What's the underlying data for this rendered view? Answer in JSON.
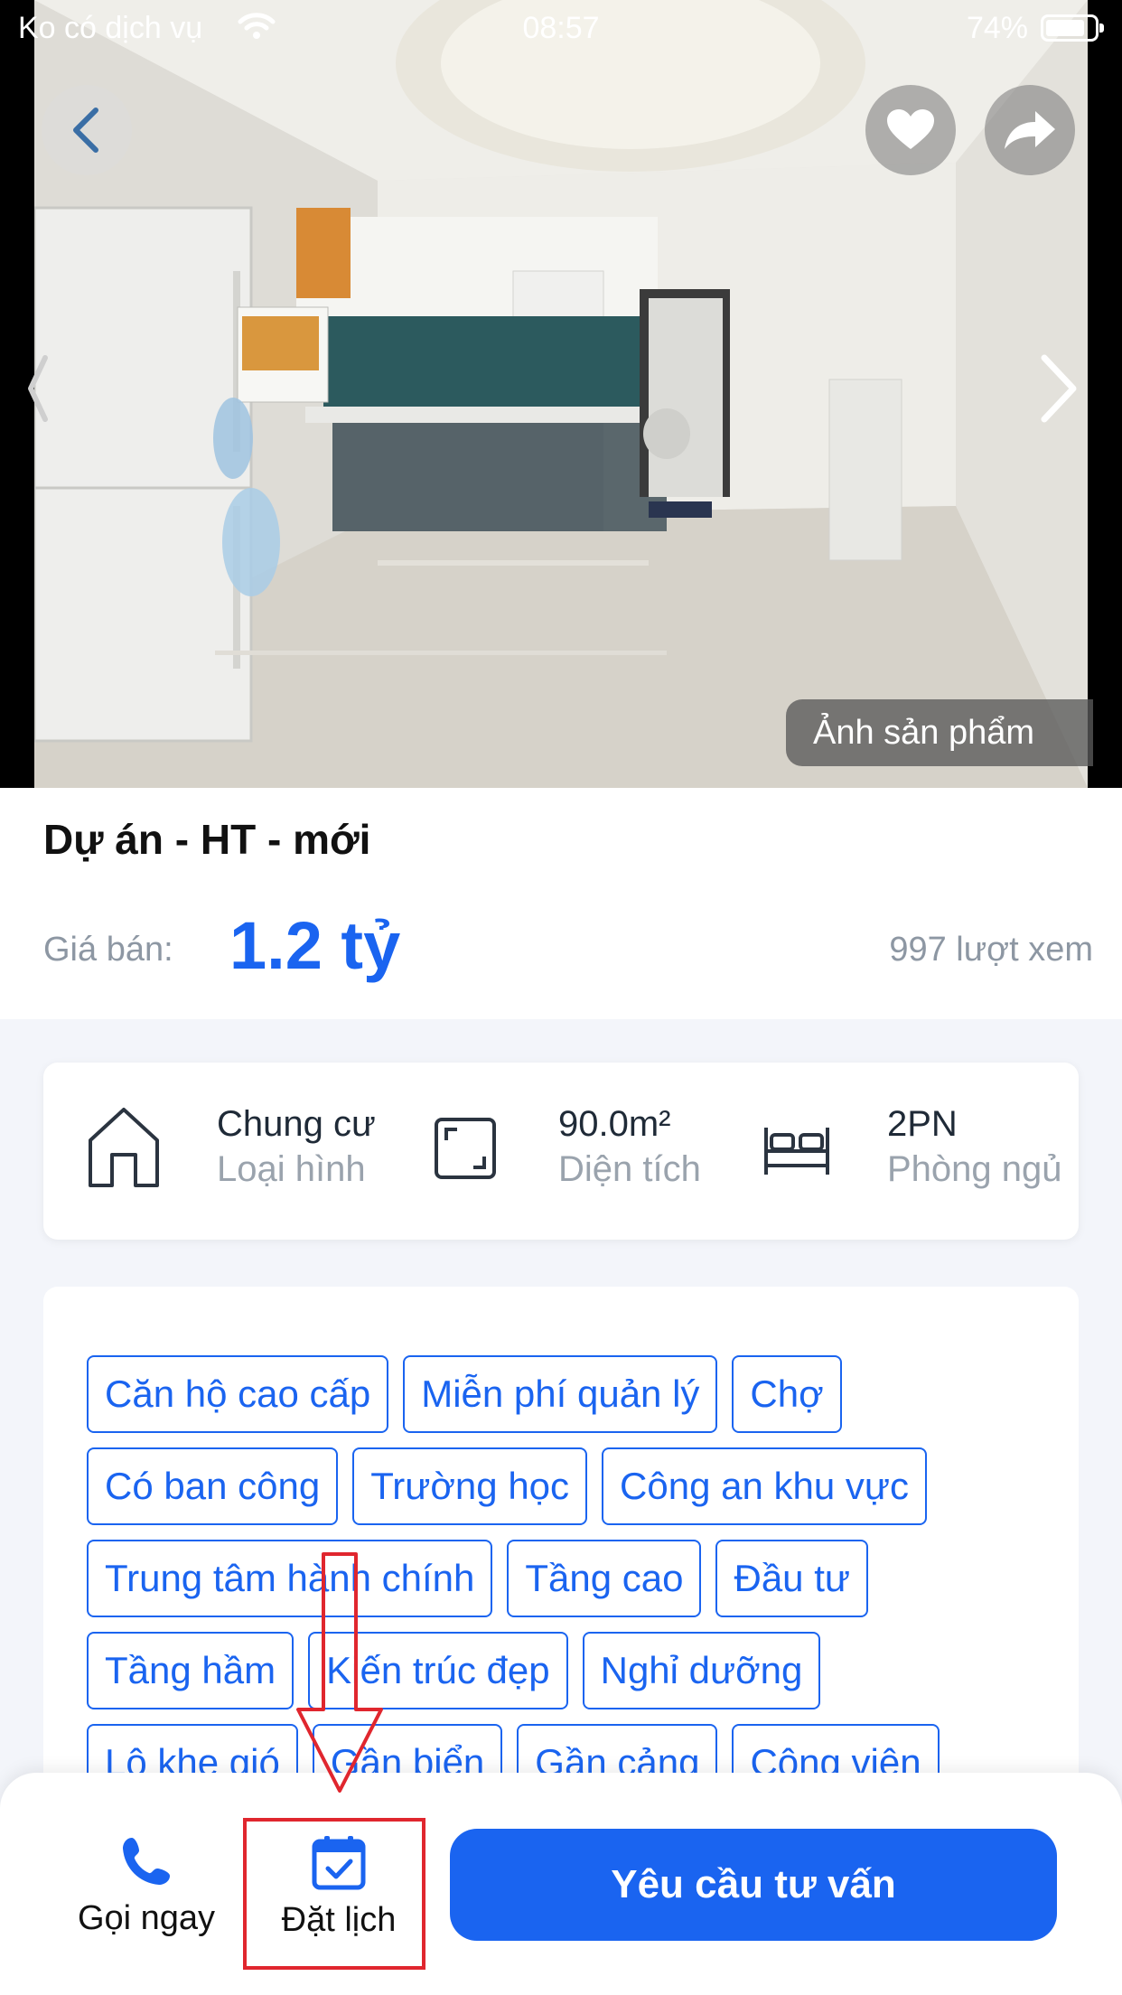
{
  "status_bar": {
    "carrier": "Ko có dịch vụ",
    "time": "08:57",
    "battery": "74%"
  },
  "hero": {
    "label": "Ảnh sản phẩm",
    "icons": [
      "back-icon",
      "heart-icon",
      "share-icon",
      "chevron-right-icon"
    ]
  },
  "listing": {
    "title": "Dự án - HT - mới",
    "price_label": "Giá bán:",
    "price": "1.2 tỷ",
    "views": "997 lượt xem"
  },
  "specs": [
    {
      "value": "Chung cư",
      "label": "Loại hình",
      "icon": "house-icon"
    },
    {
      "value": "90.0m²",
      "label": "Diện tích",
      "icon": "area-icon"
    },
    {
      "value": "2PN",
      "label": "Phòng ngủ",
      "icon": "bed-icon"
    }
  ],
  "tags": {
    "row1": [
      "Căn hộ cao cấp",
      "Miễn phí quản lý",
      "Chợ"
    ],
    "row2": [
      "Có ban công",
      "Trường học",
      "Công an khu vực"
    ],
    "row3": [
      "Trung tâm hành chính",
      "Tầng cao",
      "Đầu tư"
    ],
    "row4": [
      "Tầng hầm",
      "Kiến trúc đẹp",
      "Nghỉ dưỡng"
    ],
    "row5": [
      "Lộ khe gió",
      "Gần biển",
      "Gần cảng",
      "Công viên"
    ]
  },
  "actions": {
    "call_label": "Gọi ngay",
    "book_label": "Đặt lịch",
    "consult_label": "Yêu cầu tư vấn"
  },
  "colors": {
    "accent": "#1a64f0",
    "annotation": "#e0262e"
  }
}
